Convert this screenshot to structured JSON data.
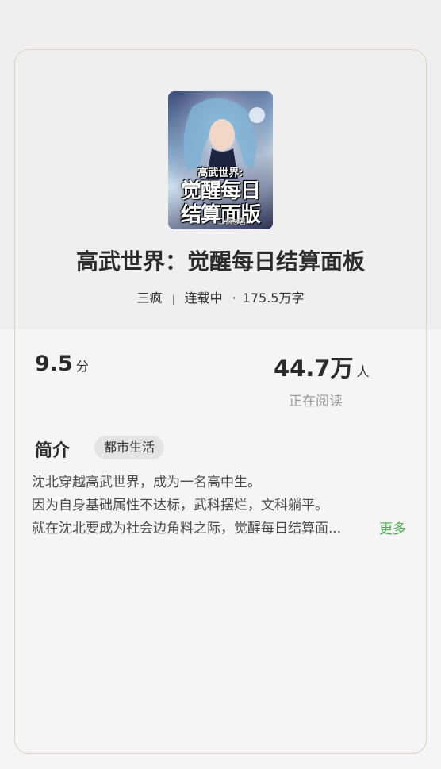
{
  "book": {
    "cover_title_line1": "高武世界:",
    "cover_title_line2": "觉醒每日",
    "cover_title_line3": "结算面版",
    "cover_author": "三疯◎著",
    "title": "高武世界：觉醒每日结算面板",
    "author": "三疯",
    "separator": "|",
    "status": "连载中",
    "dot": "·",
    "word_count": "175.5万字"
  },
  "stats": {
    "score_value": "9.5",
    "score_unit": "分",
    "readers_value": "44.7万",
    "readers_unit": "人",
    "readers_label": "正在阅读"
  },
  "intro": {
    "heading": "简介",
    "genre_tag": "都市生活",
    "lines": [
      "沈北穿越高武世界，成为一名高中生。",
      "因为自身基础属性不达标，武科摆烂，文科躺平。",
      "就在沈北要成为社会边角料之际，觉醒每日结算面..."
    ],
    "more_label": "更多"
  },
  "colors": {
    "accent_green": "#4caf50",
    "frame": "#d9d4c6"
  }
}
